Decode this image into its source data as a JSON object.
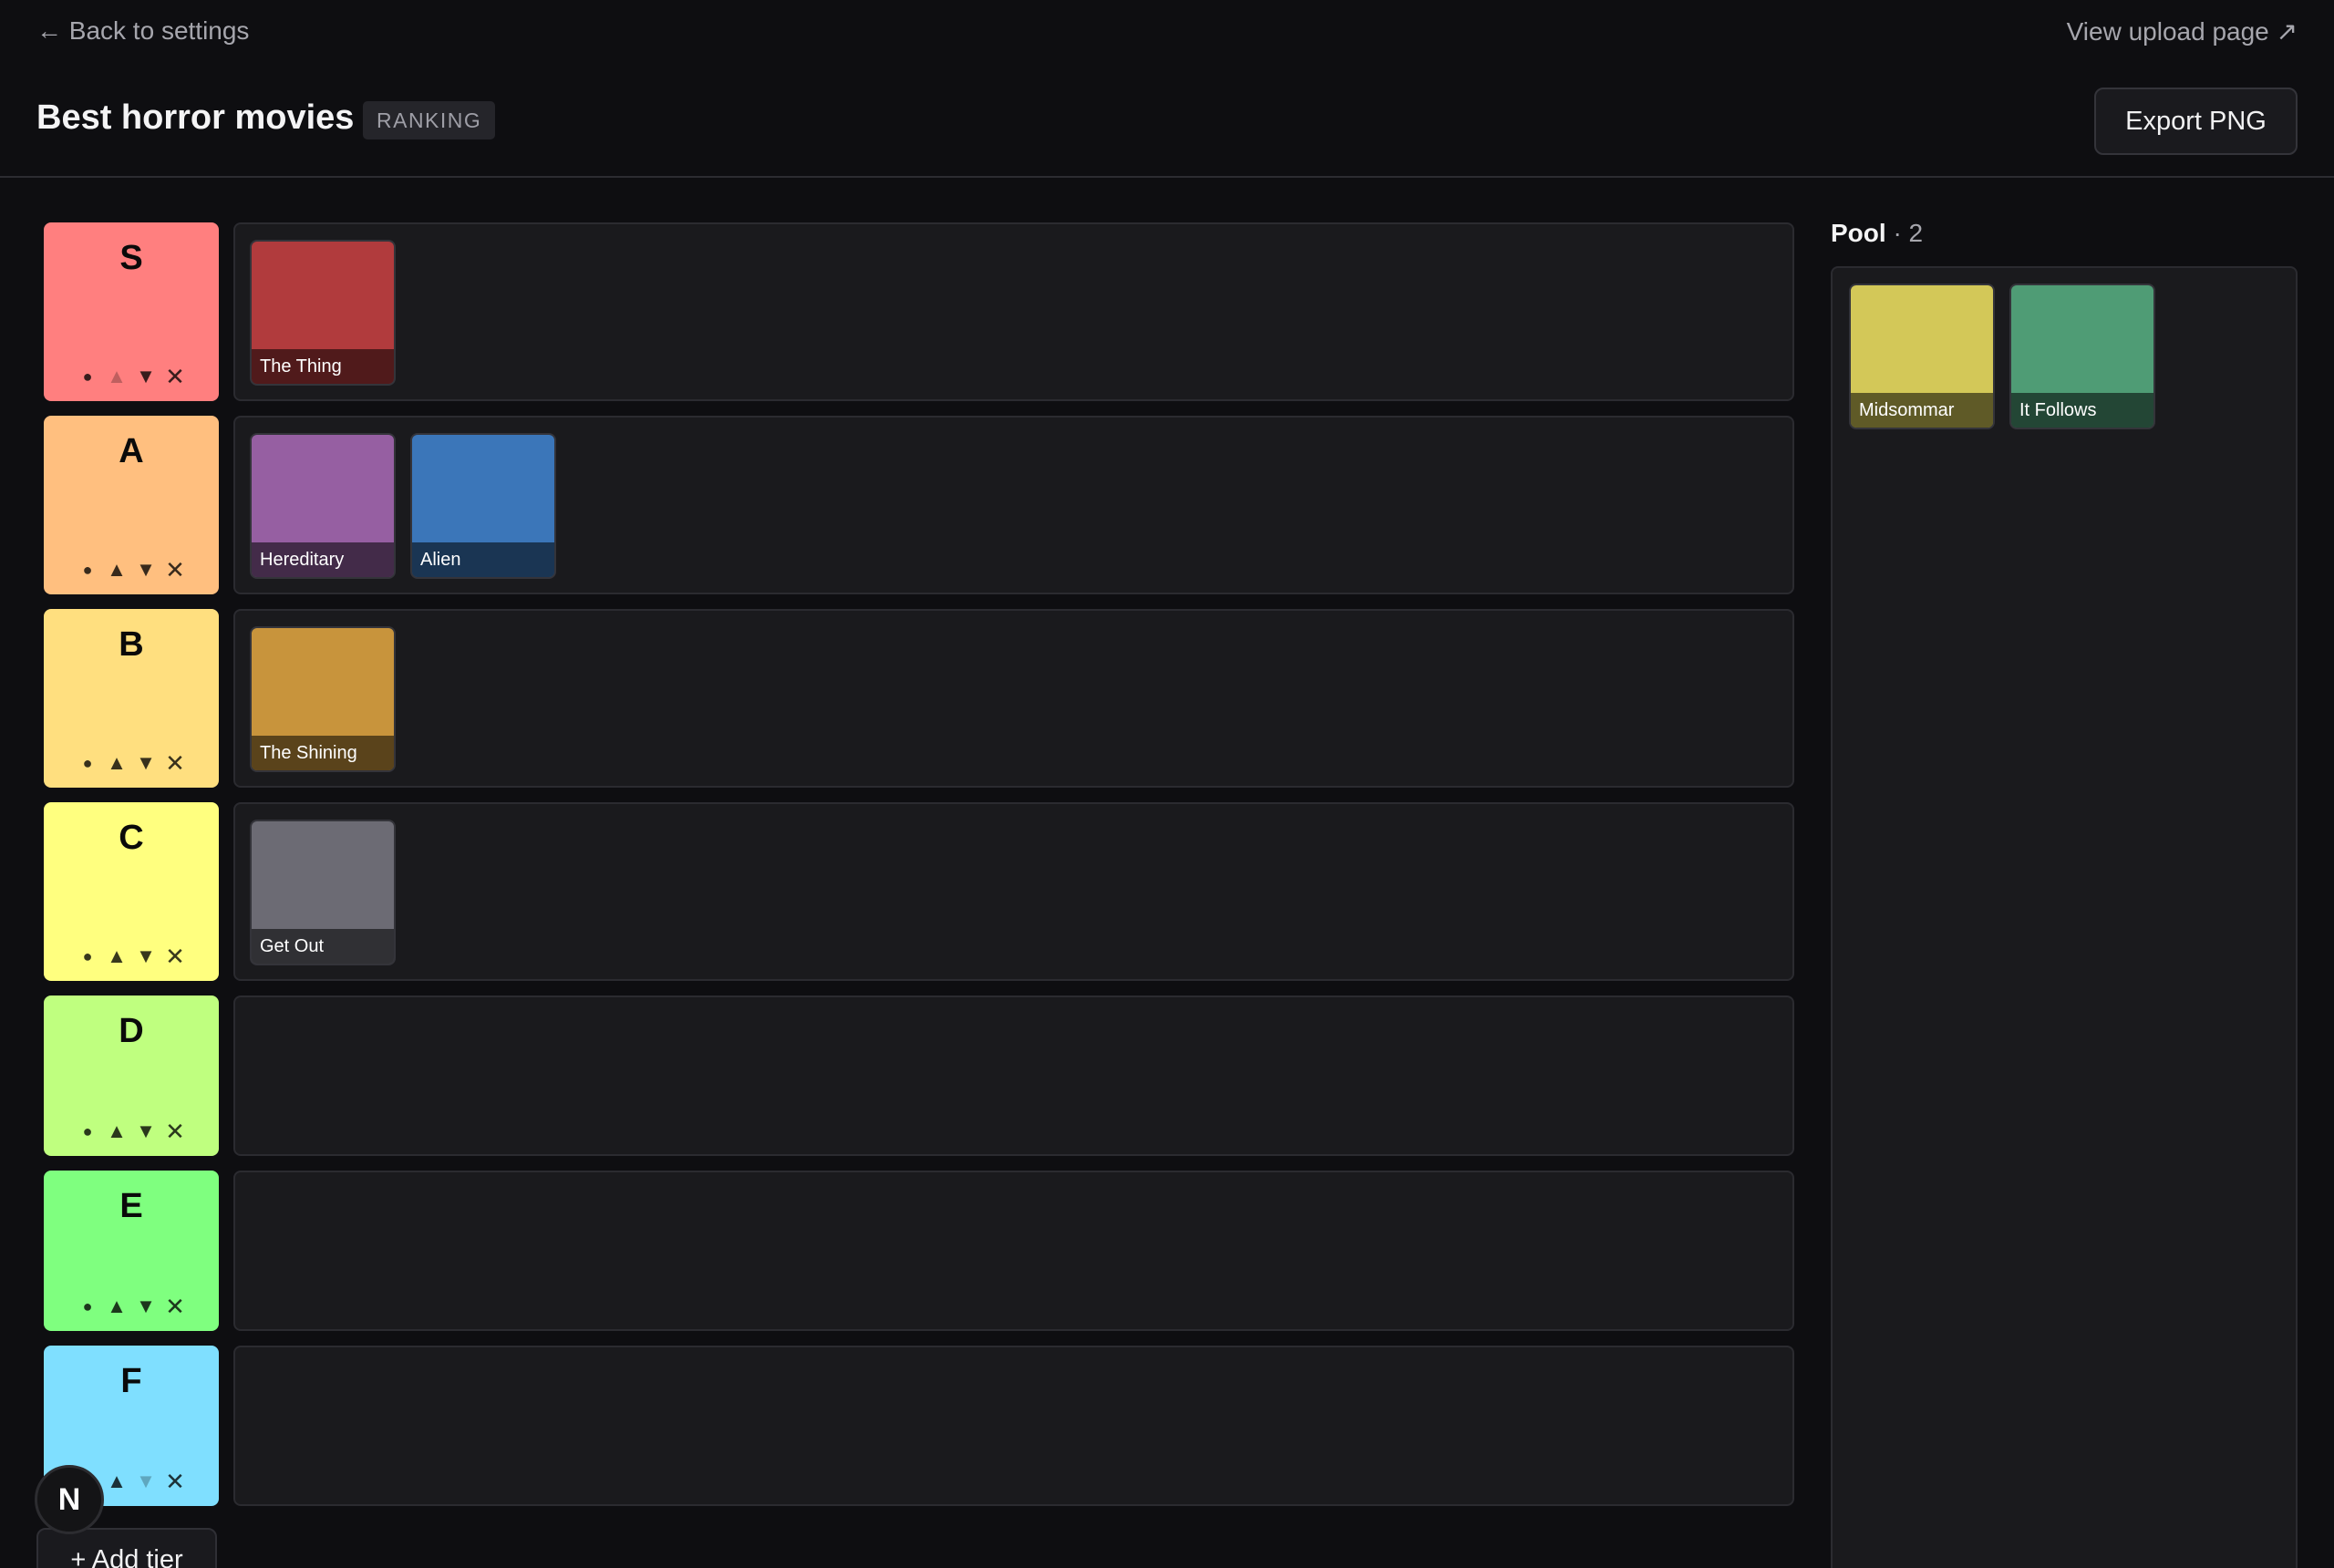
{
  "nav": {
    "back_label": "← Back to settings",
    "view_label": "View upload page ↗"
  },
  "header": {
    "title": "Best horror movies",
    "badge": "RANKING",
    "export_label": "Export PNG"
  },
  "tier_controls": {
    "dot": "●",
    "up": "▲",
    "down": "▼",
    "remove": "✕"
  },
  "tiers": [
    {
      "name": "S",
      "color": "#ff7f7f",
      "items": [
        {
          "title": "The Thing",
          "color": "#b13b3d"
        }
      ]
    },
    {
      "name": "A",
      "color": "#ffbf7f",
      "items": [
        {
          "title": "Hereditary",
          "color": "#965fa2"
        },
        {
          "title": "Alien",
          "color": "#3b76b9"
        }
      ]
    },
    {
      "name": "B",
      "color": "#ffdf7f",
      "items": [
        {
          "title": "The Shining",
          "color": "#c8943c"
        }
      ]
    },
    {
      "name": "C",
      "color": "#ffff7f",
      "items": [
        {
          "title": "Get Out",
          "color": "#6c6b74"
        }
      ]
    },
    {
      "name": "D",
      "color": "#bfff7f",
      "items": []
    },
    {
      "name": "E",
      "color": "#7fff7f",
      "items": []
    },
    {
      "name": "F",
      "color": "#7fdfff",
      "items": []
    }
  ],
  "pool": {
    "title": "Pool",
    "count": "· 2",
    "items": [
      {
        "title": "Midsommar",
        "color": "#d3c858"
      },
      {
        "title": "It Follows",
        "color": "#4f9c75"
      }
    ]
  },
  "add_tier_label": "+ Add tier",
  "next_badge": "N"
}
